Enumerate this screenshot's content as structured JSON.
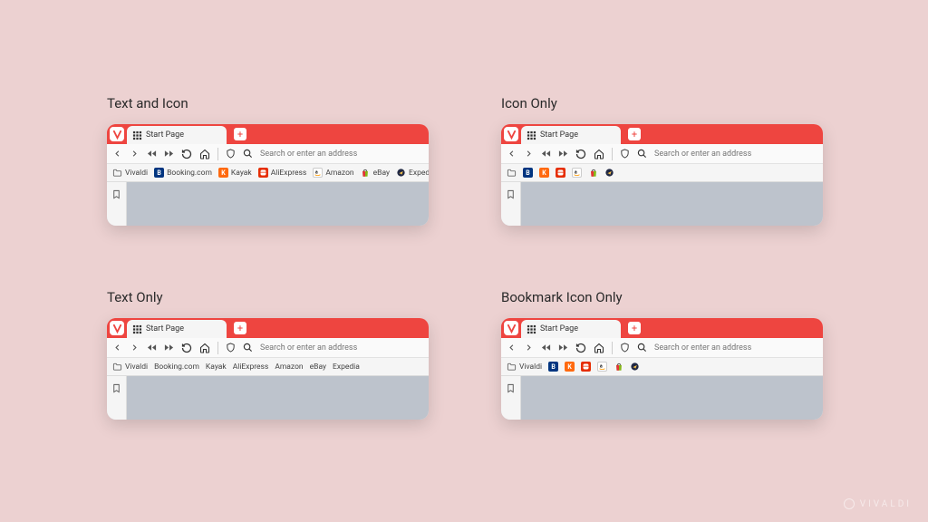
{
  "watermark": "VIVALDI",
  "addressbar": {
    "placeholder": "Search or enter an address"
  },
  "tab": {
    "title": "Start Page"
  },
  "bookmarks": [
    {
      "label": "Vivaldi",
      "icon": "folder",
      "color": "transparent"
    },
    {
      "label": "Booking.com",
      "icon": "B",
      "color": "#003580"
    },
    {
      "label": "Kayak",
      "icon": "K",
      "color": "#ff690f"
    },
    {
      "label": "AliExpress",
      "icon": "ali",
      "color": "#e62e04"
    },
    {
      "label": "Amazon",
      "icon": "a",
      "color": "#ffffff"
    },
    {
      "label": "eBay",
      "icon": "bag",
      "color": "#ffffff"
    },
    {
      "label": "Expedia",
      "icon": "plane",
      "color": "#ffc94c"
    }
  ],
  "panels": [
    {
      "caption": "Text and Icon",
      "show_text": true,
      "show_icon": true,
      "folder_text": true
    },
    {
      "caption": "Icon Only",
      "show_text": false,
      "show_icon": true,
      "folder_text": false
    },
    {
      "caption": "Text Only",
      "show_text": true,
      "show_icon": false,
      "folder_text": true
    },
    {
      "caption": "Bookmark Icon Only",
      "show_text": false,
      "show_icon": true,
      "folder_text": true
    }
  ]
}
